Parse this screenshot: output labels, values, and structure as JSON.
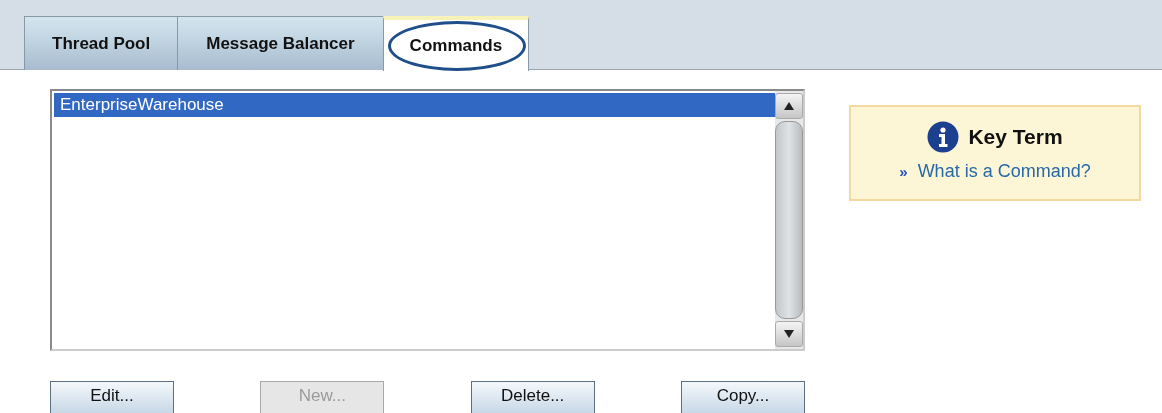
{
  "tabs": [
    {
      "label": "Thread Pool",
      "selected": false,
      "highlighted": false
    },
    {
      "label": "Message Balancer",
      "selected": false,
      "highlighted": false
    },
    {
      "label": "Commands",
      "selected": true,
      "highlighted": true
    }
  ],
  "command_list": {
    "items": [
      {
        "label": "EnterpriseWarehouse",
        "selected": true
      }
    ]
  },
  "key_term": {
    "title": "Key Term",
    "link_marker": "»",
    "link": "What is a Command?"
  },
  "buttons": [
    {
      "label": "Edit...",
      "disabled": false
    },
    {
      "label": "New...",
      "disabled": true
    },
    {
      "label": "Delete...",
      "disabled": false
    },
    {
      "label": "Copy...",
      "disabled": false
    }
  ]
}
